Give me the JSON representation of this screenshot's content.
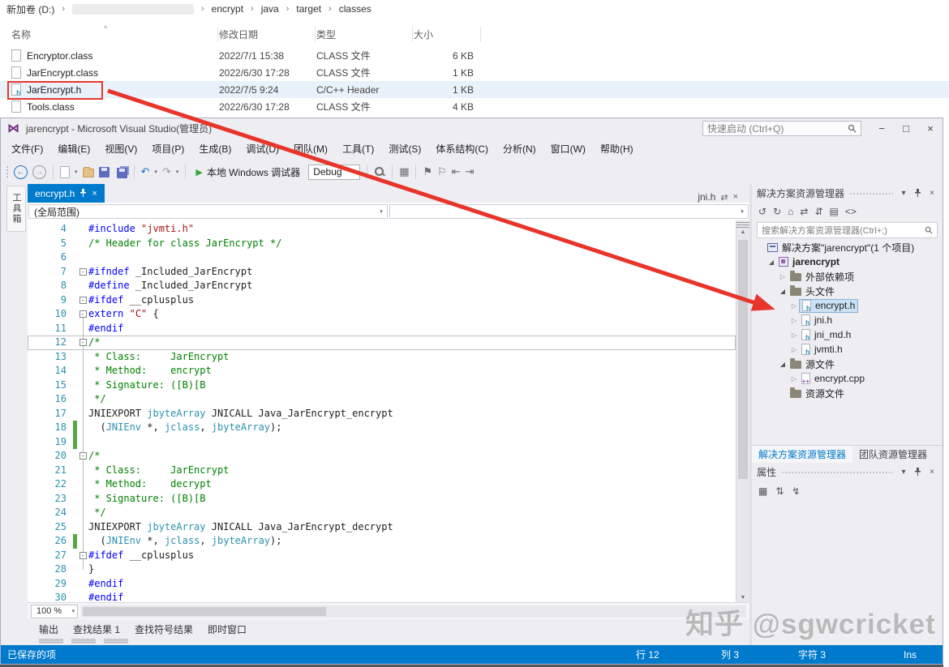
{
  "colors": {
    "accent": "#007acc",
    "arrow_red": "#e8352c",
    "change_mark_green": "#57a64a",
    "keyword_blue": "#0000ff",
    "comment_green": "#008000",
    "string_red": "#a31515",
    "type_teal": "#2b91af",
    "selection_blue": "#cbe1f6"
  },
  "explorer": {
    "path": [
      {
        "label": "新加卷 (D:)"
      },
      {
        "redacted": true
      },
      {
        "label": "encrypt"
      },
      {
        "label": "java"
      },
      {
        "label": "target"
      },
      {
        "label": "classes"
      }
    ],
    "sort_indicator": "^",
    "columns": [
      {
        "id": "name",
        "label": "名称"
      },
      {
        "id": "date",
        "label": "修改日期"
      },
      {
        "id": "type",
        "label": "类型"
      },
      {
        "id": "size",
        "label": "大小"
      }
    ],
    "files": [
      {
        "name": "Encryptor.class",
        "date": "2022/7/1 15:38",
        "type": "CLASS 文件",
        "size": "6 KB",
        "badge": "",
        "selected": false
      },
      {
        "name": "JarEncrypt.class",
        "date": "2022/6/30 17:28",
        "type": "CLASS 文件",
        "size": "1 KB",
        "badge": "",
        "selected": false
      },
      {
        "name": "JarEncrypt.h",
        "date": "2022/7/5 9:24",
        "type": "C/C++ Header",
        "size": "1 KB",
        "badge": "h",
        "selected": true
      },
      {
        "name": "Tools.class",
        "date": "2022/6/30 17:28",
        "type": "CLASS 文件",
        "size": "4 KB",
        "badge": "",
        "selected": false
      }
    ]
  },
  "vs": {
    "title": "jarencrypt - Microsoft Visual Studio(管理员)",
    "quick_launch": "快速启动 (Ctrl+Q)",
    "window_buttons": {
      "minimize": "−",
      "maximize": "□",
      "close": "×"
    },
    "menus": [
      "文件(F)",
      "编辑(E)",
      "视图(V)",
      "项目(P)",
      "生成(B)",
      "调试(D)",
      "团队(M)",
      "工具(T)",
      "测试(S)",
      "体系结构(C)",
      "分析(N)",
      "窗口(W)",
      "帮助(H)"
    ],
    "toolbar": {
      "run_label": "本地 Windows 调试器",
      "config": "Debug",
      "items": [
        {
          "kind": "dots"
        },
        {
          "kind": "circle",
          "name": "nav-back-icon",
          "glyph": "←",
          "color": "#1f72c4"
        },
        {
          "kind": "circle",
          "name": "nav-forward-icon",
          "glyph": "→",
          "color": "#9a9a9a"
        },
        {
          "kind": "sep"
        },
        {
          "kind": "page",
          "name": "new-file-icon",
          "caret": true
        },
        {
          "kind": "folder",
          "name": "open-file-icon"
        },
        {
          "kind": "floppy",
          "name": "save-icon"
        },
        {
          "kind": "floppy2",
          "name": "save-all-icon"
        },
        {
          "kind": "sep"
        },
        {
          "kind": "glyph",
          "name": "undo-icon",
          "glyph": "↶",
          "color": "#1f72c4",
          "caret": true
        },
        {
          "kind": "glyph",
          "name": "redo-icon",
          "glyph": "↷",
          "color": "#9a9a9a",
          "caret": true
        },
        {
          "kind": "sep"
        },
        {
          "kind": "run",
          "name": "start-debug-button"
        },
        {
          "kind": "combo",
          "name": "solution-configurations-combo"
        },
        {
          "kind": "sep"
        },
        {
          "kind": "mag",
          "name": "find-in-files-icon"
        },
        {
          "kind": "sep"
        },
        {
          "kind": "glyph",
          "name": "solution-platforms-icon",
          "glyph": "▦",
          "color": "#6d6d6d"
        },
        {
          "kind": "sep"
        },
        {
          "kind": "glyph",
          "name": "bookmark-icon",
          "glyph": "⚑",
          "color": "#6d6d6d"
        },
        {
          "kind": "glyph",
          "name": "bookmark-outline-icon",
          "glyph": "⚐",
          "color": "#6d6d6d"
        },
        {
          "kind": "glyph",
          "name": "indent-decrease-icon",
          "glyph": "⇤",
          "color": "#6d6d6d"
        },
        {
          "kind": "glyph",
          "name": "indent-increase-icon",
          "glyph": "⇥",
          "color": "#6d6d6d"
        }
      ]
    },
    "toolbox_tab": "工具箱",
    "editor": {
      "active_tab": "encrypt.h",
      "right_tab": "jni.h",
      "scope": "(全局范围)",
      "zoom": "100 %",
      "lines": [
        {
          "n": 4,
          "seg": [
            [
              "pp",
              "#include "
            ],
            [
              "str",
              "\"jvmti.h\""
            ]
          ]
        },
        {
          "n": 5,
          "seg": [
            [
              "com",
              "/* Header for class JarEncrypt */"
            ]
          ]
        },
        {
          "n": 6,
          "seg": []
        },
        {
          "n": 7,
          "fold": true,
          "seg": [
            [
              "pp",
              "#ifndef"
            ],
            [
              "pl",
              " _Included_JarEncrypt"
            ]
          ]
        },
        {
          "n": 8,
          "seg": [
            [
              "pp",
              "#define"
            ],
            [
              "pl",
              " _Included_JarEncrypt"
            ]
          ]
        },
        {
          "n": 9,
          "fold": true,
          "seg": [
            [
              "pp",
              "#ifdef"
            ],
            [
              "pl",
              " __cplusplus"
            ]
          ]
        },
        {
          "n": 10,
          "fold": true,
          "seg": [
            [
              "pp",
              "extern"
            ],
            [
              "pl",
              " "
            ],
            [
              "str",
              "\"C\""
            ],
            [
              "pl",
              " {"
            ]
          ]
        },
        {
          "n": 11,
          "seg": [
            [
              "pp",
              "#endif"
            ]
          ]
        },
        {
          "n": 12,
          "fold": true,
          "cur": true,
          "seg": [
            [
              "com",
              "/*"
            ]
          ]
        },
        {
          "n": 13,
          "seg": [
            [
              "com",
              " * Class:     JarEncrypt"
            ]
          ]
        },
        {
          "n": 14,
          "seg": [
            [
              "com",
              " * Method:    encrypt"
            ]
          ]
        },
        {
          "n": 15,
          "seg": [
            [
              "com",
              " * Signature: ([B)[B"
            ]
          ]
        },
        {
          "n": 16,
          "seg": [
            [
              "com",
              " */"
            ]
          ]
        },
        {
          "n": 17,
          "seg": [
            [
              "pl",
              "JNIEXPORT "
            ],
            [
              "ty",
              "jbyteArray"
            ],
            [
              "pl",
              " JNICALL Java_JarEncrypt_encrypt"
            ]
          ]
        },
        {
          "n": 18,
          "mark": true,
          "seg": [
            [
              "pl",
              "  ("
            ],
            [
              "ty",
              "JNIEnv"
            ],
            [
              "pl",
              " *, "
            ],
            [
              "ty",
              "jclass"
            ],
            [
              "pl",
              ", "
            ],
            [
              "ty",
              "jbyteArray"
            ],
            [
              "pl",
              ");"
            ]
          ]
        },
        {
          "n": 19,
          "mark": true,
          "seg": []
        },
        {
          "n": 20,
          "fold": true,
          "seg": [
            [
              "com",
              "/*"
            ]
          ]
        },
        {
          "n": 21,
          "seg": [
            [
              "com",
              " * Class:     JarEncrypt"
            ]
          ]
        },
        {
          "n": 22,
          "seg": [
            [
              "com",
              " * Method:    decrypt"
            ]
          ]
        },
        {
          "n": 23,
          "seg": [
            [
              "com",
              " * Signature: ([B)[B"
            ]
          ]
        },
        {
          "n": 24,
          "seg": [
            [
              "com",
              " */"
            ]
          ]
        },
        {
          "n": 25,
          "seg": [
            [
              "pl",
              "JNIEXPORT "
            ],
            [
              "ty",
              "jbyteArray"
            ],
            [
              "pl",
              " JNICALL Java_JarEncrypt_decrypt"
            ]
          ]
        },
        {
          "n": 26,
          "mark": true,
          "seg": [
            [
              "pl",
              "  ("
            ],
            [
              "ty",
              "JNIEnv"
            ],
            [
              "pl",
              " *, "
            ],
            [
              "ty",
              "jclass"
            ],
            [
              "pl",
              ", "
            ],
            [
              "ty",
              "jbyteArray"
            ],
            [
              "pl",
              ");"
            ]
          ]
        },
        {
          "n": 27,
          "fold": true,
          "seg": [
            [
              "pp",
              "#ifdef"
            ],
            [
              "pl",
              " __cplusplus"
            ]
          ]
        },
        {
          "n": 28,
          "seg": [
            [
              "pl",
              "}"
            ]
          ]
        },
        {
          "n": 29,
          "seg": [
            [
              "pp",
              "#endif"
            ]
          ]
        },
        {
          "n": 30,
          "seg": [
            [
              "pp",
              "#endif"
            ]
          ]
        }
      ]
    },
    "solution_explorer": {
      "title": "解决方案资源管理器",
      "search_placeholder": "搜索解决方案资源管理器(Ctrl+;)",
      "toolbar_icons": [
        {
          "name": "se-back-icon",
          "glyph": "↺"
        },
        {
          "name": "se-forward-icon",
          "glyph": "↻"
        },
        {
          "name": "se-home-icon",
          "glyph": "⌂"
        },
        {
          "name": "se-sync-icon",
          "glyph": "⇄"
        },
        {
          "name": "se-collapse-all-icon",
          "glyph": "⇵"
        },
        {
          "name": "se-properties-icon",
          "glyph": "▤"
        },
        {
          "name": "se-preview-icon",
          "glyph": "<>"
        }
      ],
      "tree": [
        {
          "label": "解决方案\"jarencrypt\"(1 个项目)",
          "indent": 0,
          "icon": "solution"
        },
        {
          "label": "jarencrypt",
          "indent": 1,
          "arrow": "exp",
          "icon": "project",
          "bold": true
        },
        {
          "label": "外部依赖项",
          "indent": 2,
          "arrow": "col",
          "icon": "folder"
        },
        {
          "label": "头文件",
          "indent": 2,
          "arrow": "exp",
          "icon": "folder"
        },
        {
          "label": "encrypt.h",
          "indent": 3,
          "arrow": "col",
          "icon": "h",
          "icon_badge": "h",
          "selected": true
        },
        {
          "label": "jni.h",
          "indent": 3,
          "arrow": "col",
          "icon": "h",
          "icon_badge": "h"
        },
        {
          "label": "jni_md.h",
          "indent": 3,
          "arrow": "col",
          "icon": "h",
          "icon_badge": "h"
        },
        {
          "label": "jvmti.h",
          "indent": 3,
          "arrow": "col",
          "icon": "h",
          "icon_badge": "h"
        },
        {
          "label": "源文件",
          "indent": 2,
          "arrow": "exp",
          "icon": "folder"
        },
        {
          "label": "encrypt.cpp",
          "indent": 3,
          "arrow": "col",
          "icon": "cpp",
          "icon_badge": "++"
        },
        {
          "label": "资源文件",
          "indent": 2,
          "icon": "folder"
        }
      ],
      "bottom_tabs": [
        {
          "label": "解决方案资源管理器",
          "active": true
        },
        {
          "label": "团队资源管理器",
          "active": false
        }
      ]
    },
    "properties_panel": {
      "title": "属性",
      "toolbar_icons": [
        {
          "name": "categorized-icon",
          "glyph": "▦"
        },
        {
          "name": "alphabetical-icon",
          "glyph": "⇅"
        },
        {
          "name": "events-icon",
          "glyph": "↯"
        }
      ]
    },
    "output_tabs": [
      "输出",
      "查找结果 1",
      "查找符号结果",
      "即时窗口"
    ],
    "status_bar": {
      "saved": "已保存的项",
      "line": "行 12",
      "col": "列 3",
      "char": "字符 3",
      "ins": "Ins"
    }
  },
  "watermark": "知乎 @sgwcricket"
}
